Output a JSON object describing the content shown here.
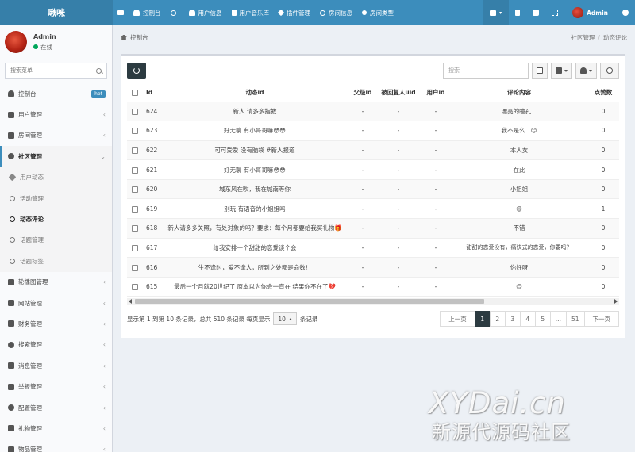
{
  "app": {
    "logo": "啾咪"
  },
  "topnav": {
    "items": [
      {
        "label": "控制台",
        "icon": "dashboard-icon"
      },
      {
        "label": "",
        "icon": "circle-icon"
      },
      {
        "label": "用户信息",
        "icon": "user-icon"
      },
      {
        "label": "用户音乐库",
        "icon": "music-icon"
      },
      {
        "label": "插件管理",
        "icon": "rocket-icon"
      },
      {
        "label": "房间信息",
        "icon": "circle-icon"
      },
      {
        "label": "房间类型",
        "icon": "dot-icon"
      }
    ],
    "user_name": "Admin"
  },
  "sidebar": {
    "user_name": "Admin",
    "user_status": "在线",
    "search_placeholder": "搜索菜单",
    "items": [
      {
        "label": "控制台",
        "icon": "dashboard-icon",
        "badge": "hot"
      },
      {
        "label": "用户管理",
        "icon": "user-icon"
      },
      {
        "label": "房间管理",
        "icon": "bank-icon"
      },
      {
        "label": "社区管理",
        "icon": "bicycle-icon",
        "open": true
      }
    ],
    "submenu": [
      {
        "label": "用户动态",
        "icon": "pencil-icon"
      },
      {
        "label": "活动管理",
        "icon": "circle-icon"
      },
      {
        "label": "动态评论",
        "icon": "circle-icon",
        "active": true
      },
      {
        "label": "话题管理",
        "icon": "circle-icon"
      },
      {
        "label": "话题标签",
        "icon": "circle-icon"
      }
    ],
    "items_after": [
      {
        "label": "轮播图管理",
        "icon": "image-icon"
      },
      {
        "label": "网站管理",
        "icon": "code-icon"
      },
      {
        "label": "财务管理",
        "icon": "list-icon"
      },
      {
        "label": "搜索管理",
        "icon": "search-icon"
      },
      {
        "label": "消息管理",
        "icon": "message-icon"
      },
      {
        "label": "举报管理",
        "icon": "flag-icon"
      },
      {
        "label": "配置管理",
        "icon": "gear-icon"
      },
      {
        "label": "礼物管理",
        "icon": "gift-icon"
      },
      {
        "label": "物品管理",
        "icon": "box-icon"
      }
    ]
  },
  "breadcrumb": {
    "home": "控制台",
    "parent": "社区管理",
    "current": "动态评论"
  },
  "toolbar": {
    "search_placeholder": "搜索"
  },
  "table": {
    "columns": [
      "Id",
      "动态id",
      "父级id",
      "被回复人uid",
      "用户id",
      "评论内容",
      "点赞数"
    ],
    "rows": [
      {
        "id": "624",
        "dyn": "新人 请多多指教",
        "parent": "-",
        "reply": "-",
        "uid": "-",
        "content": "漂亮的瞳孔...",
        "likes": "0"
      },
      {
        "id": "623",
        "dyn": "好无聊 有小哥哥嘛😳😳",
        "parent": "-",
        "reply": "-",
        "uid": "-",
        "content": "我不是么...😊",
        "likes": "0"
      },
      {
        "id": "622",
        "dyn": "可可爱爱 没有脑袋 #新人报道",
        "parent": "-",
        "reply": "-",
        "uid": "-",
        "content": "本人女",
        "likes": "0"
      },
      {
        "id": "621",
        "dyn": "好无聊 有小哥哥嘛😳😳",
        "parent": "-",
        "reply": "-",
        "uid": "-",
        "content": "在此",
        "likes": "0"
      },
      {
        "id": "620",
        "dyn": "城东风在吹，我在城南等你",
        "parent": "-",
        "reply": "-",
        "uid": "-",
        "content": "小姐姐",
        "likes": "0"
      },
      {
        "id": "619",
        "dyn": "别玩 有语音的小姐姐吗",
        "parent": "-",
        "reply": "-",
        "uid": "-",
        "content": "😊",
        "likes": "1"
      },
      {
        "id": "618",
        "dyn": "新人请多多关照，有处对象的吗？要求：每个月都要给我买礼物🎁",
        "parent": "-",
        "reply": "-",
        "uid": "-",
        "content": "不错",
        "likes": "0"
      },
      {
        "id": "617",
        "dyn": "给我安排一个甜甜的恋爱谈个会",
        "parent": "-",
        "reply": "-",
        "uid": "-",
        "content": "甜甜的恋爱没有，痛快式的恋爱，你要吗？",
        "likes": "0"
      },
      {
        "id": "616",
        "dyn": "生不逢时，爱不逢人，所到之处都是命数！",
        "parent": "-",
        "reply": "-",
        "uid": "-",
        "content": "你好呀",
        "likes": "0"
      },
      {
        "id": "615",
        "dyn": "最后一个月就20世纪了 原本以为你会一直在 结果你不在了💔",
        "parent": "-",
        "reply": "-",
        "uid": "-",
        "content": "😊",
        "likes": "0"
      }
    ]
  },
  "footer": {
    "summary": "显示第 1 到第 10 条记录，总共 510 条记录 每页显示",
    "page_size": "10",
    "suffix": "条记录",
    "pager": [
      "上一页",
      "1",
      "2",
      "3",
      "4",
      "5",
      "...",
      "51",
      "下一页"
    ],
    "current_page": "1"
  },
  "watermark": {
    "latin": "XYDai.cn",
    "cjk": "新源代源码社区"
  },
  "colors": {
    "header": "#3c8dbc",
    "logo_bg": "#367fa9",
    "dark_btn": "#2c3b41",
    "online": "#00a65a"
  }
}
